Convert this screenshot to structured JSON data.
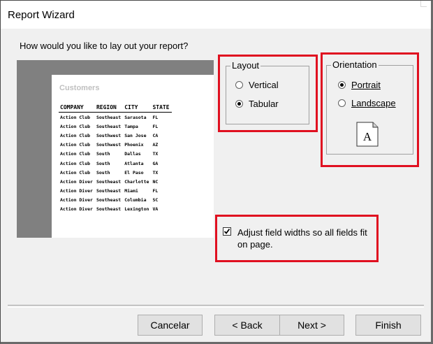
{
  "window": {
    "title": "Report Wizard"
  },
  "prompt": "How would you like to lay out your report?",
  "preview": {
    "title": "Customers",
    "columns": [
      "COMPANY",
      "REGION",
      "CITY",
      "STATE"
    ],
    "rows": [
      [
        "Action Club",
        "Southeast",
        "Sarasota",
        "FL"
      ],
      [
        "Action Club",
        "Southeast",
        "Tampa",
        "FL"
      ],
      [
        "Action Club",
        "Southwest",
        "San Jose",
        "CA"
      ],
      [
        "Action Club",
        "Southwest",
        "Phoenix",
        "AZ"
      ],
      [
        "Action Club",
        "South",
        "Dallas",
        "TX"
      ],
      [
        "Action Club",
        "South",
        "Atlanta",
        "GA"
      ],
      [
        "Action Club",
        "South",
        "El Paso",
        "TX"
      ],
      [
        "Action Diver",
        "Southeast",
        "Charlotte",
        "NC"
      ],
      [
        "Action Diver",
        "Southeast",
        "Miami",
        "FL"
      ],
      [
        "Action Diver",
        "Southeast",
        "Columbia",
        "SC"
      ],
      [
        "Action Diver",
        "Southeast",
        "Lexington",
        "VA"
      ]
    ]
  },
  "layout": {
    "label": "Layout",
    "options": [
      {
        "label": "Vertical",
        "selected": false
      },
      {
        "label": "Tabular",
        "selected": true
      }
    ]
  },
  "orientation": {
    "label": "Orientation",
    "options": [
      {
        "label": "Portrait",
        "selected": true
      },
      {
        "label": "Landscape",
        "selected": false
      }
    ],
    "icon_letter": "A"
  },
  "adjust": {
    "label": "Adjust field widths so all fields fit on page.",
    "checked": true
  },
  "buttons": {
    "cancel": "Cancelar",
    "back": "< Back",
    "next": "Next >",
    "finish": "Finish"
  },
  "colors": {
    "highlight": "#e01020",
    "preview_bg": "#808080"
  }
}
